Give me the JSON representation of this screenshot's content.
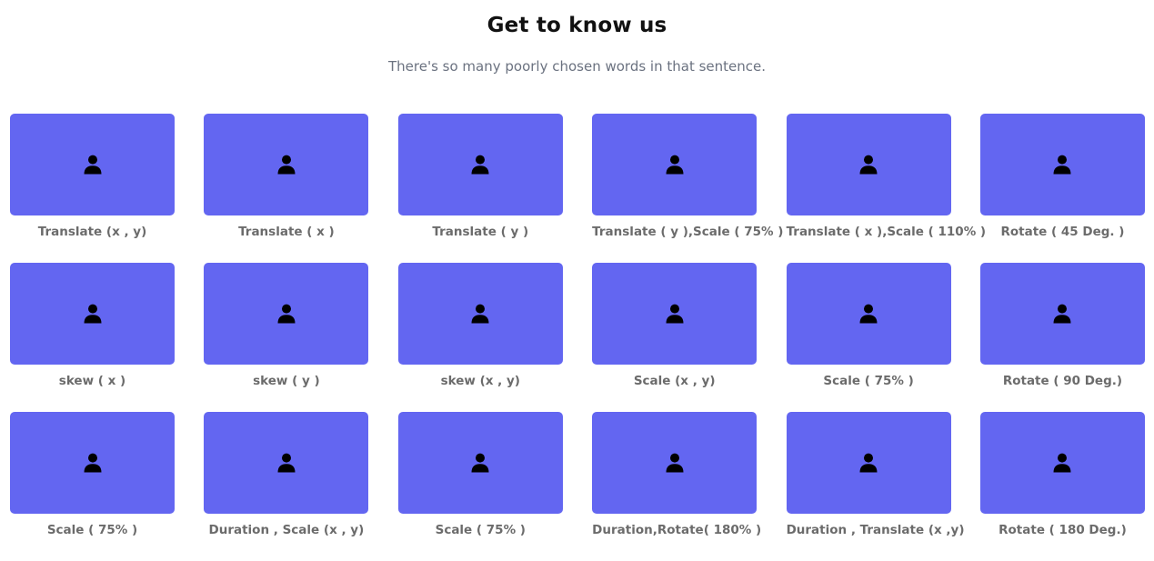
{
  "header": {
    "title": "Get to know us",
    "subtitle": "There's so many poorly chosen words in that sentence."
  },
  "theme": {
    "card_color": "#6366f1",
    "icon": "user-icon"
  },
  "cards": [
    {
      "label": "Translate (x , y)"
    },
    {
      "label": "Translate ( x )"
    },
    {
      "label": "Translate ( y )"
    },
    {
      "label": "Translate ( y ),Scale ( 75% )"
    },
    {
      "label": "Translate ( x ),Scale ( 110% )"
    },
    {
      "label": "Rotate ( 45 Deg. )"
    },
    {
      "label": "skew ( x )"
    },
    {
      "label": "skew ( y )"
    },
    {
      "label": "skew (x , y)"
    },
    {
      "label": "Scale (x , y)"
    },
    {
      "label": "Scale ( 75% )"
    },
    {
      "label": "Rotate ( 90 Deg.)"
    },
    {
      "label": "Scale ( 75% )"
    },
    {
      "label": "Duration , Scale (x , y)"
    },
    {
      "label": "Scale ( 75% )"
    },
    {
      "label": "Duration,Rotate( 180% )"
    },
    {
      "label": "Duration , Translate (x ,y)"
    },
    {
      "label": "Rotate ( 180 Deg.)"
    }
  ]
}
